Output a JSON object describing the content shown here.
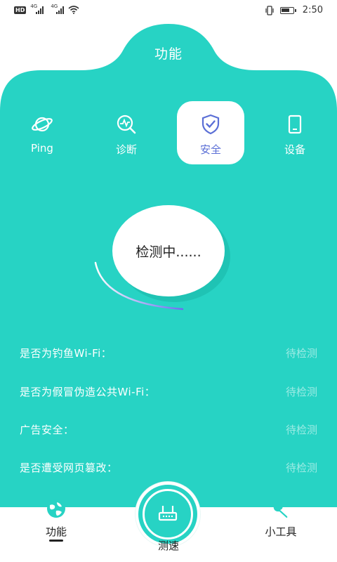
{
  "status_bar": {
    "hd": "HD",
    "sim1": "4G",
    "sim2": "4G",
    "time": "2:50"
  },
  "header": {
    "title": "功能"
  },
  "tabs": [
    {
      "label": "Ping",
      "icon": "planet-icon"
    },
    {
      "label": "诊断",
      "icon": "diagnose-icon"
    },
    {
      "label": "安全",
      "icon": "shield-check-icon",
      "active": true
    },
    {
      "label": "设备",
      "icon": "phone-device-icon"
    }
  ],
  "detect": {
    "text": "检测中......"
  },
  "checks": [
    {
      "question": "是否为钓鱼Wi-Fi：",
      "status": "待检测"
    },
    {
      "question": "是否为假冒伪造公共Wi-Fi：",
      "status": "待检测"
    },
    {
      "question": "广告安全：",
      "status": "待检测"
    },
    {
      "question": "是否遭受网页篡改：",
      "status": "待检测"
    }
  ],
  "bottom_nav": {
    "left": {
      "label": "功能",
      "icon": "globe-icon"
    },
    "center": {
      "label": "测速",
      "icon": "router-icon"
    },
    "right": {
      "label": "小工具",
      "icon": "wrench-icon"
    }
  },
  "colors": {
    "teal": "#27d3c4",
    "active_tab_text": "#5b6fd6",
    "status_pending": "rgba(255,255,255,0.55)"
  }
}
